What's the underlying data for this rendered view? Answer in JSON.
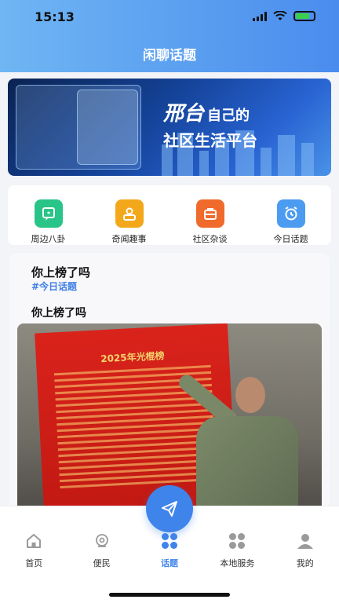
{
  "status": {
    "time": "15:13"
  },
  "header": {
    "title": "闲聊话题"
  },
  "banner": {
    "brand": "邢台",
    "line1_suffix": "自己的",
    "line2": "社区生活平台"
  },
  "quick_nav": [
    {
      "label": "周边八卦",
      "icon": "gossip-icon",
      "color": "#29c487"
    },
    {
      "label": "奇闻趣事",
      "icon": "person-news-icon",
      "color": "#f3a81c"
    },
    {
      "label": "社区杂谈",
      "icon": "briefcase-icon",
      "color": "#f06a2c"
    },
    {
      "label": "今日话题",
      "icon": "clock-icon",
      "color": "#4b9cf0"
    }
  ],
  "post": {
    "title": "你上榜了吗",
    "tag": "#今日话题",
    "subtitle": "你上榜了吗",
    "image_title": "2025年光棍榜"
  },
  "fab": {
    "icon": "paper-plane-icon"
  },
  "tabbar": {
    "items": [
      {
        "label": "首页",
        "icon": "home-icon",
        "active": false
      },
      {
        "label": "便民",
        "icon": "service-icon",
        "active": false
      },
      {
        "label": "话题",
        "icon": "topics-icon",
        "active": true
      },
      {
        "label": "本地服务",
        "icon": "local-service-icon",
        "active": false
      },
      {
        "label": "我的",
        "icon": "profile-icon",
        "active": false
      }
    ],
    "active_color": "#3f84ea",
    "inactive_color": "#9a9a9a"
  }
}
